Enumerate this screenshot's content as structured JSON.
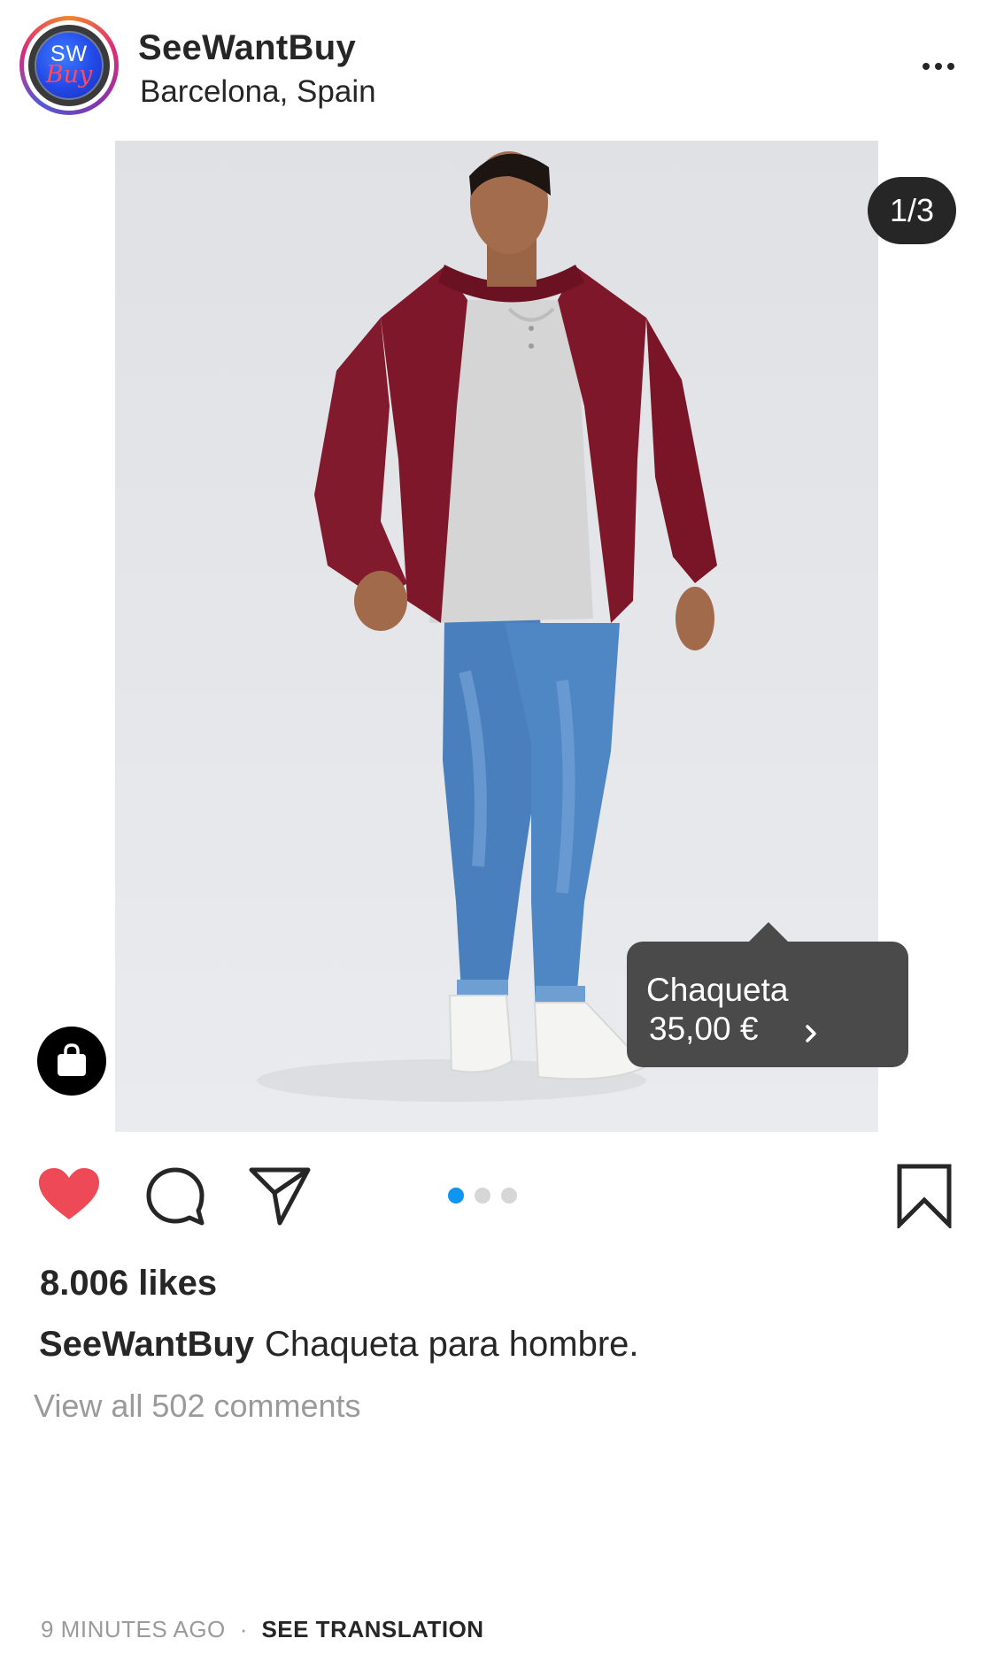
{
  "post": {
    "username": "SeeWantBuy",
    "location": "Barcelona, Spain",
    "avatar": {
      "line1": "SW",
      "line2": "Buy"
    },
    "more_icon": "ellipsis-icon"
  },
  "media": {
    "counter": "1/3",
    "image_icon": "photo-man-in-red-bomber-jacket",
    "current_index": 1,
    "total": 3,
    "product_tag": {
      "name": "Chaqueta",
      "price": "35,00 €",
      "chevron_icon": "chevron-right-icon"
    },
    "shop_icon": "shopping-bag-icon"
  },
  "actions": {
    "like_icon": "heart-icon",
    "liked": true,
    "comment_icon": "comment-bubble-icon",
    "share_icon": "paper-plane-icon",
    "save_icon": "bookmark-icon"
  },
  "likes": "8.006 likes",
  "caption": {
    "username": "SeeWantBuy",
    "text": "Chaqueta para hombre."
  },
  "comments_link": "View all 502 comments",
  "timestamp": "9 MINUTES AGO",
  "separator": "·",
  "translation_link": "SEE TRANSLATION",
  "colors": {
    "text": "#262626",
    "muted": "#9a9a9a",
    "like": "#ed4956",
    "active_dot": "#0d95f0",
    "inactive_dot": "#d6d6d6",
    "tag_bg": "#4a4a4a",
    "jacket": "#7e1729",
    "jeans": "#4a7fbd"
  }
}
